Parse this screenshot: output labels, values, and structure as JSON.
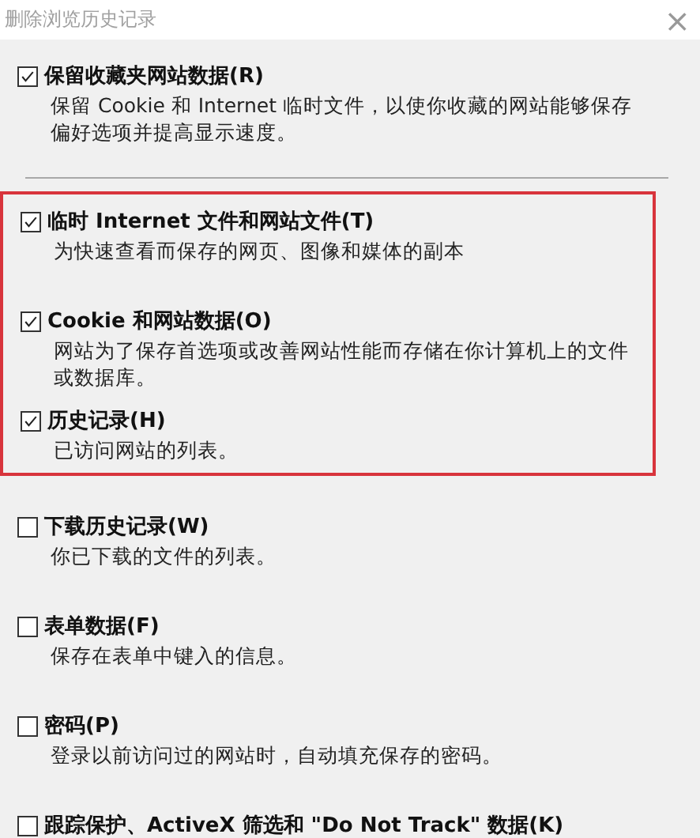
{
  "window": {
    "title": "删除浏览历史记录",
    "close": "×"
  },
  "top_options": [
    {
      "label": "保留收藏夹网站数据(R)",
      "description": "保留 Cookie 和 Internet 临时文件，以使你收藏的网站能够保存偏好选项并提高显示速度。",
      "checked": true
    }
  ],
  "highlighted_options": [
    {
      "label": "临时 Internet 文件和网站文件(T)",
      "description": "为快速查看而保存的网页、图像和媒体的副本",
      "checked": true
    },
    {
      "label": "Cookie 和网站数据(O)",
      "description": "网站为了保存首选项或改善网站性能而存储在你计算机上的文件或数据库。",
      "checked": true
    },
    {
      "label": "历史记录(H)",
      "description": "已访问网站的列表。",
      "checked": true
    }
  ],
  "other_options": [
    {
      "label": "下载历史记录(W)",
      "description": "你已下载的文件的列表。",
      "checked": false
    },
    {
      "label": "表单数据(F)",
      "description": "保存在表单中键入的信息。",
      "checked": false
    },
    {
      "label": "密码(P)",
      "description": "登录以前访问过的网站时，自动填充保存的密码。",
      "checked": false
    },
    {
      "label": "跟踪保护、ActiveX 筛选和 \"Do Not Track\" 数据(K)",
      "checked": false
    }
  ]
}
